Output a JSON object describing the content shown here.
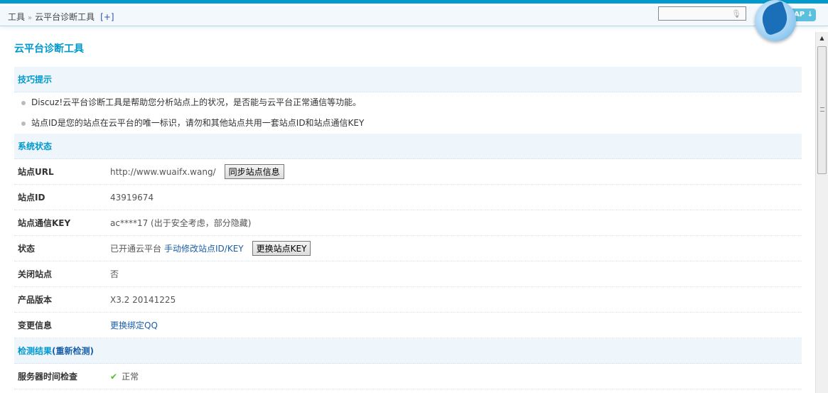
{
  "breadcrumb": {
    "root": "工具",
    "current": "云平台诊断工具",
    "add": "[+]"
  },
  "header": {
    "app_button": "AP ↓"
  },
  "page_title": "云平台诊断工具",
  "tips": {
    "title": "技巧提示",
    "items": [
      "Discuz!云平台诊断工具是帮助您分析站点上的状况，是否能与云平台正常通信等功能。",
      "站点ID是您的站点在云平台的唯一标识，请勿和其他站点共用一套站点ID和站点通信KEY"
    ]
  },
  "system": {
    "title": "系统状态",
    "url": {
      "label": "站点URL",
      "value": "http://www.wuaifx.wang/",
      "button": "同步站点信息"
    },
    "site_id": {
      "label": "站点ID",
      "value": "43919674"
    },
    "key": {
      "label": "站点通信KEY",
      "value": "ac****17 (出于安全考虑，部分隐藏)"
    },
    "status": {
      "label": "状态",
      "value": "已开通云平台",
      "link": "手动修改站点ID/KEY",
      "button": "更换站点KEY"
    },
    "closed": {
      "label": "关闭站点",
      "value": "否"
    },
    "version": {
      "label": "产品版本",
      "value": "X3.2 20141225"
    },
    "change": {
      "label": "变更信息",
      "link": "更换绑定QQ"
    }
  },
  "results": {
    "title": "检测结果",
    "recheck": "(重新检测)",
    "rows": [
      {
        "label": "服务器时间检查",
        "value": "正常"
      }
    ]
  }
}
